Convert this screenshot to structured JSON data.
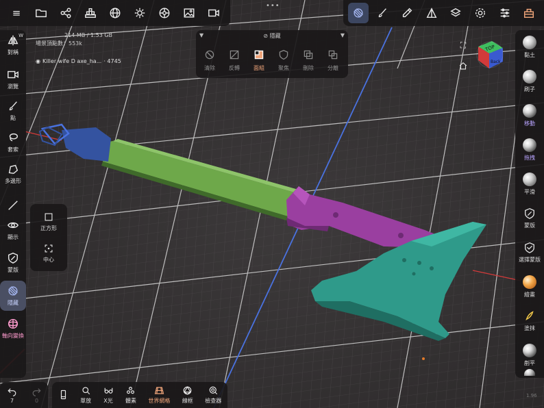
{
  "topbar": {
    "left_icons": [
      "folder-icon",
      "share-icon",
      "scene-icon",
      "sphere-grid-icon",
      "sun-icon",
      "material-icon",
      "image-icon",
      "video-icon"
    ],
    "right_icons": [
      "selected-mask-icon",
      "brush-icon",
      "dropper-icon",
      "triangle-icon",
      "layers-icon",
      "gear-icon",
      "sliders-icon",
      "toolbox-icon"
    ]
  },
  "info": {
    "memory": "214 MB / 1.53 GB",
    "vertices": "場景頂點數：553k",
    "mesh_name": "Killer wife D axe_ha...",
    "mesh_count": "4745"
  },
  "hide_panel": {
    "title": "隱藏",
    "buttons": [
      "清除",
      "反轉",
      "面組",
      "聚焦",
      "刪除",
      "分離"
    ],
    "active": "面組"
  },
  "left_sidebar": {
    "items": [
      "對稱",
      "瀏覽",
      "點",
      "套索",
      "多邊形",
      "顯示",
      "蒙版",
      "隱藏",
      "軸向變換"
    ],
    "active": "隱藏",
    "badge": "W"
  },
  "shape_panel": {
    "items": [
      "正方形",
      "中心"
    ]
  },
  "right_sidebar": {
    "items": [
      "黏土",
      "刷子",
      "移動",
      "拖拽",
      "平滑",
      "蒙版",
      "選擇蒙版",
      "繪畫",
      "塗抹",
      "剷平"
    ],
    "highlight": [
      "移動",
      "拖拽"
    ]
  },
  "bottom_left": {
    "undo": "7",
    "redo": "0"
  },
  "bottom_bar": {
    "items": [
      "",
      "單放",
      "X光",
      "體素",
      "世界網格",
      "線框",
      "檢查器"
    ],
    "active": "世界網格"
  },
  "gizmo": {
    "top_label": "TOP",
    "back_label": "Back"
  },
  "fps": "1.96",
  "colors": {
    "accent": "#f0a57a",
    "axe_handle": "#6ea84a",
    "axe_head": "#9a3fa0",
    "axe_blade": "#2f9a8a",
    "axe_pommel": "#3453a0",
    "grid_line": "#e8e8e8",
    "blue_axis": "#4a72e0",
    "red_axis": "#d23a3a"
  }
}
